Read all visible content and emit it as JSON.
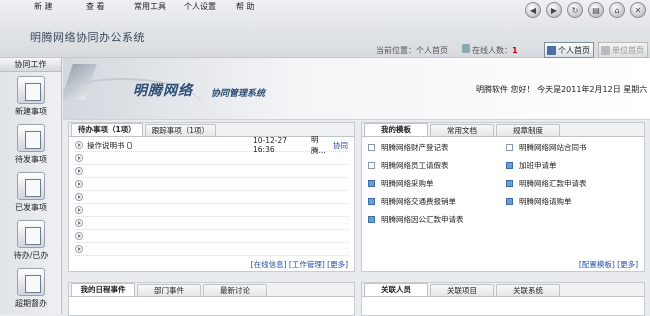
{
  "menu": [
    "新 建",
    "查 看",
    "常用工具",
    "个人设置",
    "帮 助"
  ],
  "window_buttons": [
    "back-icon",
    "forward-icon",
    "refresh-icon",
    "print-icon",
    "home-icon",
    "close-icon"
  ],
  "app_title": "明腾网络协同办公系统",
  "location": {
    "label": "当前位置：个人首页"
  },
  "online": {
    "label": "在线人数：",
    "count": "1"
  },
  "toolbar": {
    "home": "个人首页",
    "unit_home": "单位首页"
  },
  "sidebar": {
    "header": "协同工作",
    "items": [
      {
        "label": "新建事项",
        "icon": "new-item-icon"
      },
      {
        "label": "待发事项",
        "icon": "pending-send-icon"
      },
      {
        "label": "已发事项",
        "icon": "sent-icon"
      },
      {
        "label": "待办/已办",
        "icon": "todo-done-icon"
      },
      {
        "label": "超期督办",
        "icon": "overdue-icon"
      }
    ]
  },
  "banner": {
    "brand": "明腾网络",
    "subtitle": "协同管理系统",
    "user_greeting": "明腾软件  您好！ 今天是2011年2月12日  星期六"
  },
  "tasks_panel": {
    "tabs": [
      "待办事项（1项）",
      "跟踪事项（1项）"
    ],
    "rows": [
      {
        "title": "操作说明书",
        "date": "10-12-27 16:36",
        "who": "明腾...",
        "action": "协同"
      }
    ],
    "links": [
      "[在线信息]",
      "[工作管理]",
      "[更多]"
    ]
  },
  "templates_panel": {
    "tabs": [
      "我的模板",
      "常用文档",
      "规章制度"
    ],
    "items": [
      {
        "label": "明腾网络财产登记表",
        "icon_color": "plain"
      },
      {
        "label": "明腾网络网站合同书",
        "icon_color": "plain"
      },
      {
        "label": "明腾网络员工请假表",
        "icon_color": "plain"
      },
      {
        "label": "加班申请单",
        "icon_color": "blue"
      },
      {
        "label": "明腾网络采购单",
        "icon_color": "blue"
      },
      {
        "label": "明腾网络汇款申请表",
        "icon_color": "blue"
      },
      {
        "label": "明腾网络交通费报销单",
        "icon_color": "blue"
      },
      {
        "label": "明腾网络请购单",
        "icon_color": "blue"
      },
      {
        "label": "明腾网络因公汇款申请表",
        "icon_color": "blue"
      }
    ],
    "links": [
      "[配置模板]",
      "[更多]"
    ]
  },
  "schedule_panel": {
    "tabs": [
      "我的日程事件",
      "部门事件",
      "最新讨论"
    ]
  },
  "related_panel": {
    "tabs": [
      "关联人员",
      "关联项目",
      "关联系统"
    ]
  }
}
